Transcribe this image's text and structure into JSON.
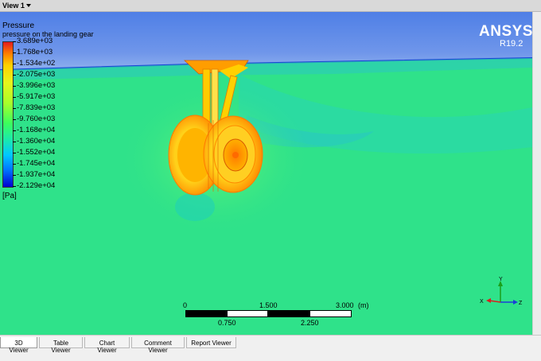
{
  "window": {
    "view_label": "View 1"
  },
  "brand": {
    "name": "ANSYS",
    "version": "R19.2"
  },
  "legend": {
    "title": "Pressure",
    "subtitle": "pressure on the landing gear",
    "unit": "[Pa]",
    "values": [
      "3.689e+03",
      "1.768e+03",
      "-1.534e+02",
      "-2.075e+03",
      "-3.996e+03",
      "-5.917e+03",
      "-7.839e+03",
      "-9.760e+03",
      "-1.168e+04",
      "-1.360e+04",
      "-1.552e+04",
      "-1.745e+04",
      "-1.937e+04",
      "-2.129e+04"
    ]
  },
  "scale": {
    "top": [
      "0",
      "1.500",
      "3.000"
    ],
    "unit": "(m)",
    "bottom": [
      "0.750",
      "2.250"
    ]
  },
  "axes": {
    "x": "X",
    "y": "Y",
    "z": "Z"
  },
  "tabs": [
    "3D Viewer",
    "Table Viewer",
    "Chart Viewer",
    "Comment Viewer",
    "Report Viewer"
  ],
  "colors": {
    "flow_field": "#2fe28a",
    "upper_field": "#6f8ee8",
    "gear_hot": "#ff9a00",
    "gear_warm": "#ffd000"
  }
}
